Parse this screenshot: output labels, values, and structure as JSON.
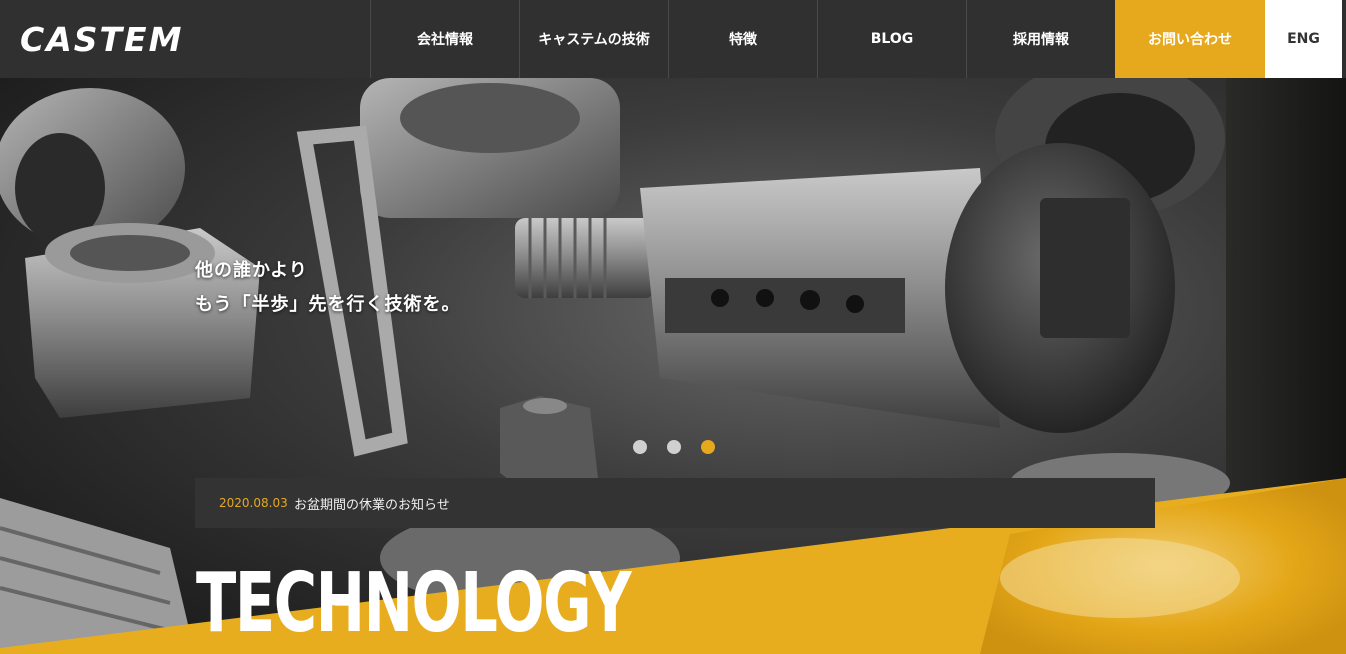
{
  "header": {
    "logo": "CASTEM",
    "nav": [
      "会社情報",
      "キャステムの技術",
      "特徴",
      "BLOG",
      "採用情報"
    ],
    "contact": "お問い合わせ",
    "lang": "ENG"
  },
  "hero": {
    "tagline_line1": "他の誰かより",
    "tagline_line2": "もう「半歩」先を行く技術を。",
    "slider": {
      "count": 3,
      "active": 3
    }
  },
  "news": {
    "date": "2020.08.03",
    "title": "お盆期間の休業のお知らせ"
  },
  "section": {
    "heading": "TECHNOLOGY"
  },
  "colors": {
    "accent": "#e6a91e",
    "header_bg": "#303030",
    "news_bg": "#333333"
  }
}
